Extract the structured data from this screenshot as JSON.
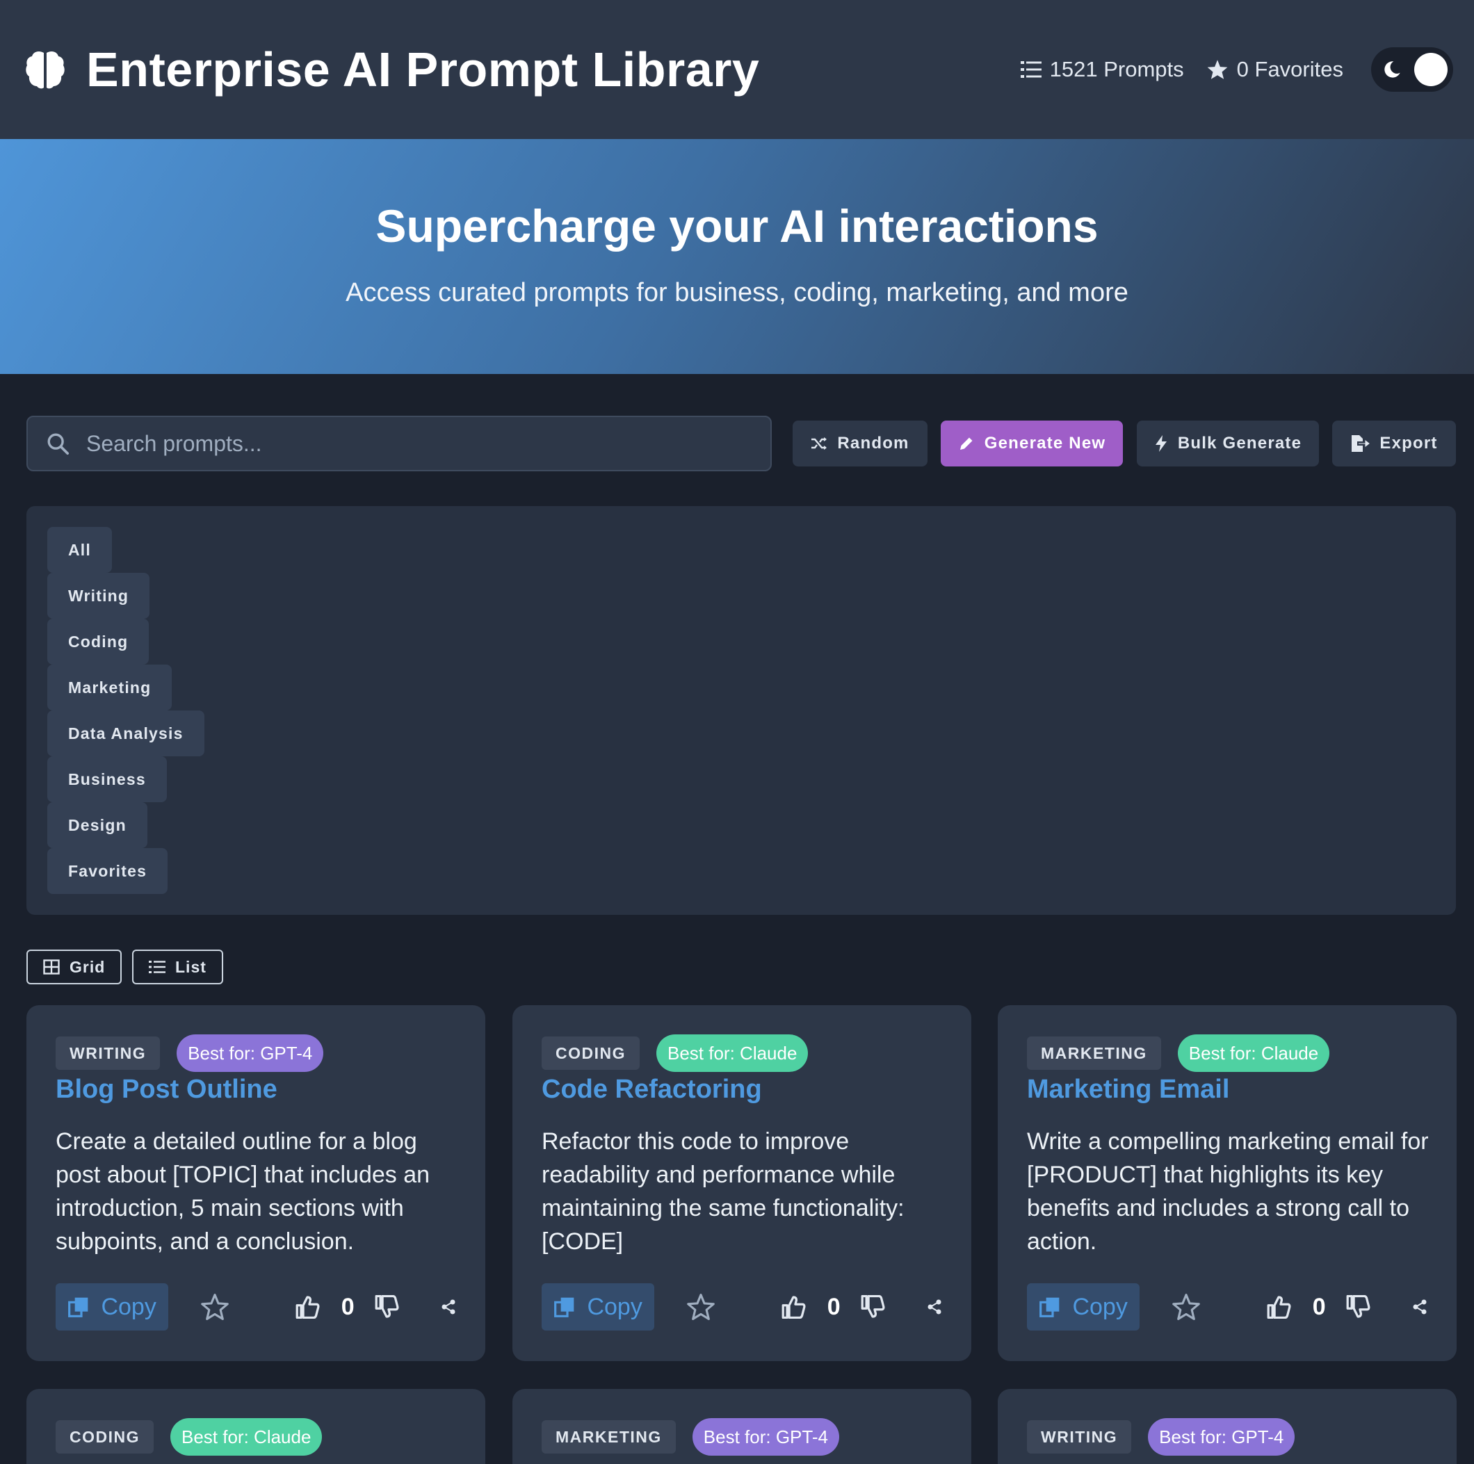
{
  "header": {
    "title": "Enterprise AI Prompt Library",
    "prompt_count": "1521 Prompts",
    "favorites_count": "0 Favorites",
    "logo_icon": "brain-icon"
  },
  "hero": {
    "title": "Supercharge your AI interactions",
    "subtitle": "Access curated prompts for business, coding, marketing, and more"
  },
  "toolbar": {
    "search_placeholder": "Search prompts...",
    "random_label": "Random",
    "generate_label": "Generate New",
    "bulk_label": "Bulk Generate",
    "export_label": "Export"
  },
  "categories": [
    "All",
    "Writing",
    "Coding",
    "Marketing",
    "Data Analysis",
    "Business",
    "Design",
    "Favorites"
  ],
  "view": {
    "grid_label": "Grid",
    "list_label": "List"
  },
  "cards": [
    {
      "category": "WRITING",
      "model": "Best for: GPT-4",
      "model_type": "gpt",
      "title": "Blog Post Outline",
      "text": "Create a detailed outline for a blog post about [TOPIC] that includes an introduction, 5 main sections with subpoints, and a conclusion.",
      "copy_label": "Copy",
      "votes": "0"
    },
    {
      "category": "CODING",
      "model": "Best for: Claude",
      "model_type": "claude",
      "title": "Code Refactoring",
      "text": "Refactor this code to improve readability and performance while maintaining the same functionality: [CODE]",
      "copy_label": "Copy",
      "votes": "0"
    },
    {
      "category": "MARKETING",
      "model": "Best for: Claude",
      "model_type": "claude",
      "title": "Marketing Email",
      "text": "Write a compelling marketing email for [PRODUCT] that highlights its key benefits and includes a strong call to action.",
      "copy_label": "Copy",
      "votes": "0"
    },
    {
      "category": "CODING",
      "model": "Best for: Claude",
      "model_type": "claude"
    },
    {
      "category": "MARKETING",
      "model": "Best for: GPT-4",
      "model_type": "gpt"
    },
    {
      "category": "WRITING",
      "model": "Best for: GPT-4",
      "model_type": "gpt"
    }
  ],
  "colors": {
    "background": "#1a202c",
    "surface": "#2d3748",
    "accent_blue": "#4f9ae0",
    "generate_purple": "#9f5ec8",
    "gpt_badge": "#8b74d8",
    "claude_badge": "#4fd1a2"
  }
}
